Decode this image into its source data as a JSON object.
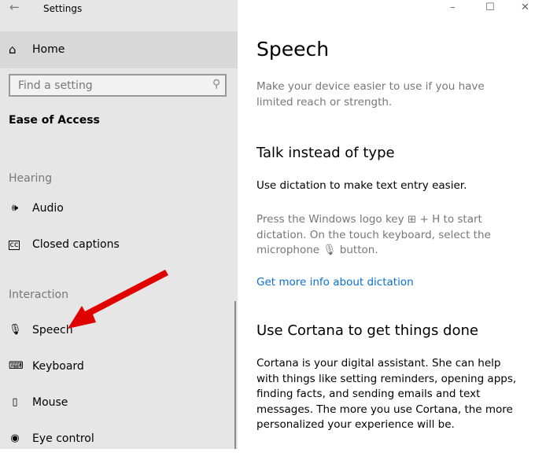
{
  "window": {
    "title": "Settings",
    "back_icon": "arrow-left-icon",
    "minimize": "–",
    "maximize": "☐",
    "close": "✕"
  },
  "sidebar": {
    "home": "Home",
    "search_placeholder": "Find a setting",
    "category": "Ease of Access",
    "groups": [
      {
        "title": "Hearing",
        "items": [
          {
            "label": "Audio",
            "icon": "🕪"
          },
          {
            "label": "Closed captions",
            "icon": "㏄"
          }
        ]
      },
      {
        "title": "Interaction",
        "items": [
          {
            "label": "Speech",
            "icon": "🎙"
          },
          {
            "label": "Keyboard",
            "icon": "⌨"
          },
          {
            "label": "Mouse",
            "icon": "🖱"
          },
          {
            "label": "Eye control",
            "icon": "👁"
          }
        ]
      }
    ]
  },
  "main": {
    "title": "Speech",
    "intro": "Make your device easier to use if you have limited reach or strength.",
    "sections": [
      {
        "heading": "Talk instead of type",
        "text": "Use dictation to make text entry easier.",
        "hint_part1": "Press the Windows logo key ",
        "hint_part2": " + H to start dictation. On the touch keyboard, select the microphone ",
        "hint_part3": " button.",
        "link": "Get more info about dictation"
      },
      {
        "heading": "Use Cortana to get things done",
        "text": "Cortana is your digital assistant.  She can help with things like setting reminders, opening apps, finding facts, and sending emails and text messages.  The more you use Cortana, the more personalized your experience will be."
      }
    ]
  },
  "annotation": {
    "arrow_color": "#e00000"
  }
}
